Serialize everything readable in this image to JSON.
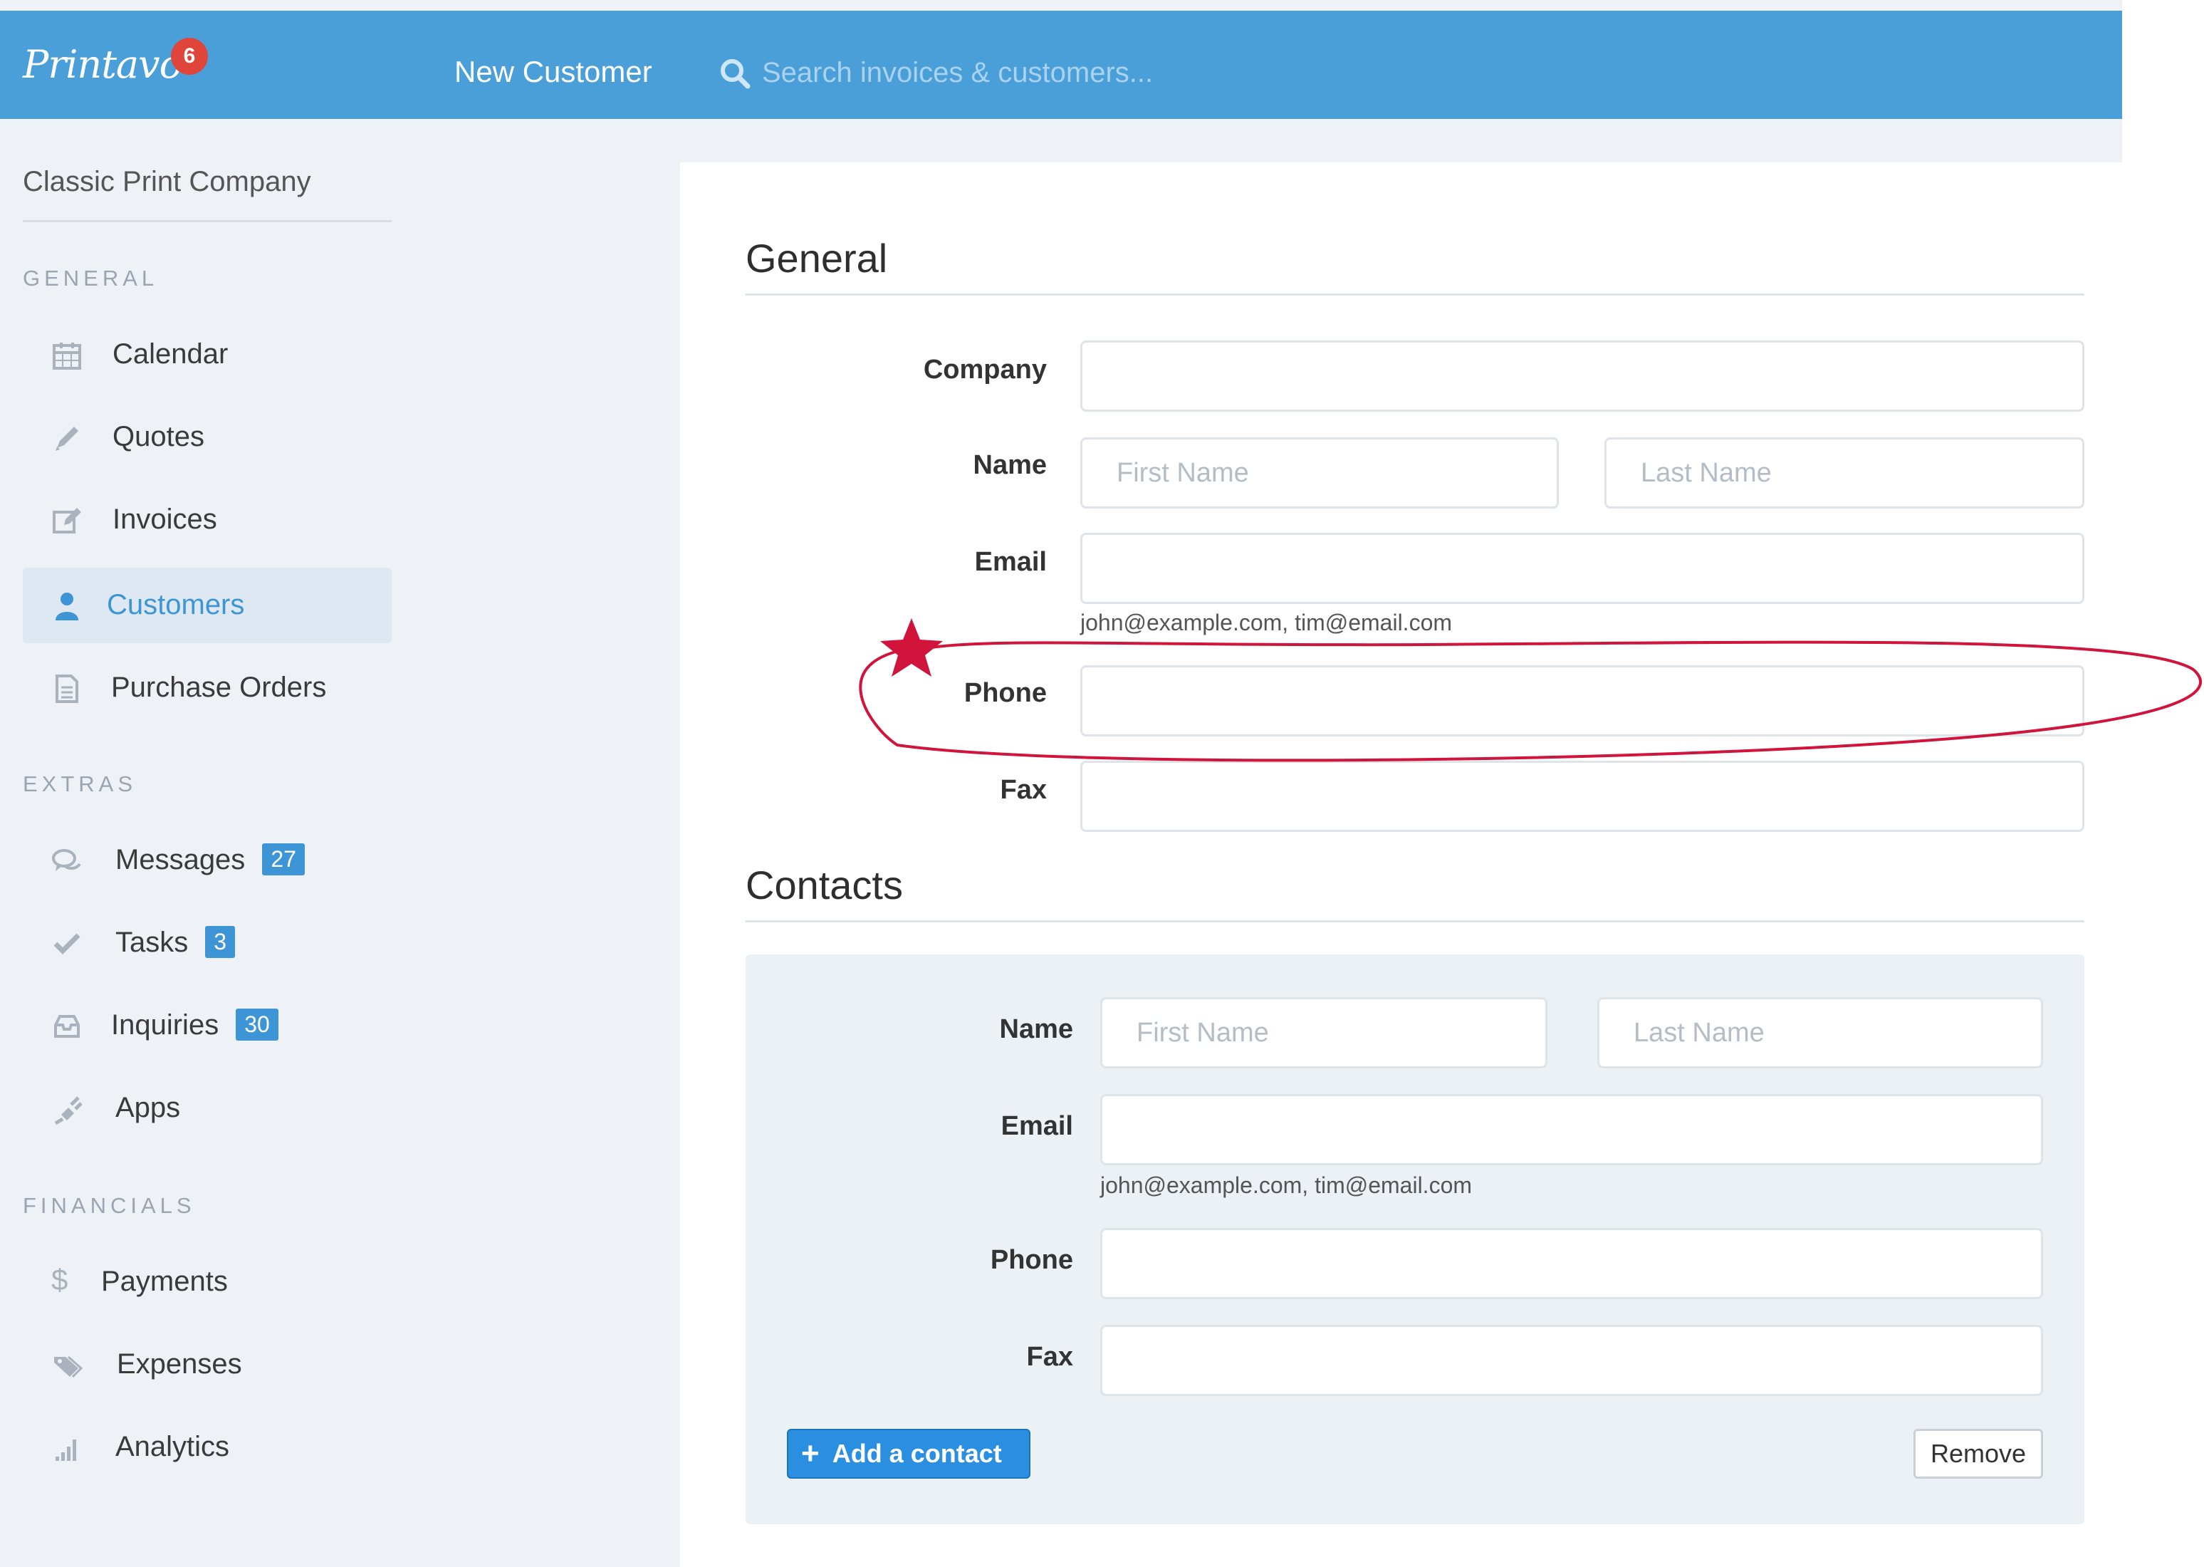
{
  "topbar": {
    "logo_text": "Printavo",
    "notification_count": "6",
    "page_title": "New Customer",
    "search": {
      "placeholder": "Search invoices & customers..."
    }
  },
  "sidebar": {
    "company": "Classic Print Company",
    "sections": [
      {
        "heading": "GENERAL"
      },
      {
        "heading": "EXTRAS"
      },
      {
        "heading": "FINANCIALS"
      }
    ],
    "items": [
      {
        "label": "Calendar",
        "icon": "calendar-icon"
      },
      {
        "label": "Quotes",
        "icon": "pencil-icon"
      },
      {
        "label": "Invoices",
        "icon": "edit-icon"
      },
      {
        "label": "Customers",
        "icon": "user-icon",
        "active": true
      },
      {
        "label": "Purchase Orders",
        "icon": "document-icon"
      },
      {
        "label": "Messages",
        "icon": "chat-icon",
        "badge": "27"
      },
      {
        "label": "Tasks",
        "icon": "check-icon",
        "badge": "3"
      },
      {
        "label": "Inquiries",
        "icon": "inbox-icon",
        "badge": "30"
      },
      {
        "label": "Apps",
        "icon": "plug-icon"
      },
      {
        "label": "Payments",
        "icon": "dollar-icon"
      },
      {
        "label": "Expenses",
        "icon": "tags-icon"
      },
      {
        "label": "Analytics",
        "icon": "signal-bars-icon"
      }
    ]
  },
  "general": {
    "title": "General",
    "company_label": "Company",
    "name_label": "Name",
    "first_name_placeholder": "First Name",
    "last_name_placeholder": "Last Name",
    "email_label": "Email",
    "email_hint": "john@example.com, tim@email.com",
    "phone_label": "Phone",
    "fax_label": "Fax"
  },
  "contacts": {
    "title": "Contacts",
    "name_label": "Name",
    "first_name_placeholder": "First Name",
    "last_name_placeholder": "Last Name",
    "email_label": "Email",
    "email_hint": "john@example.com, tim@email.com",
    "phone_label": "Phone",
    "fax_label": "Fax",
    "add_button": "Add a contact",
    "remove_button": "Remove"
  },
  "colors": {
    "topbar": "#4a9fd8",
    "accent": "#3d95d6",
    "badge_red": "#e0453b",
    "annotation": "#d0143c"
  }
}
